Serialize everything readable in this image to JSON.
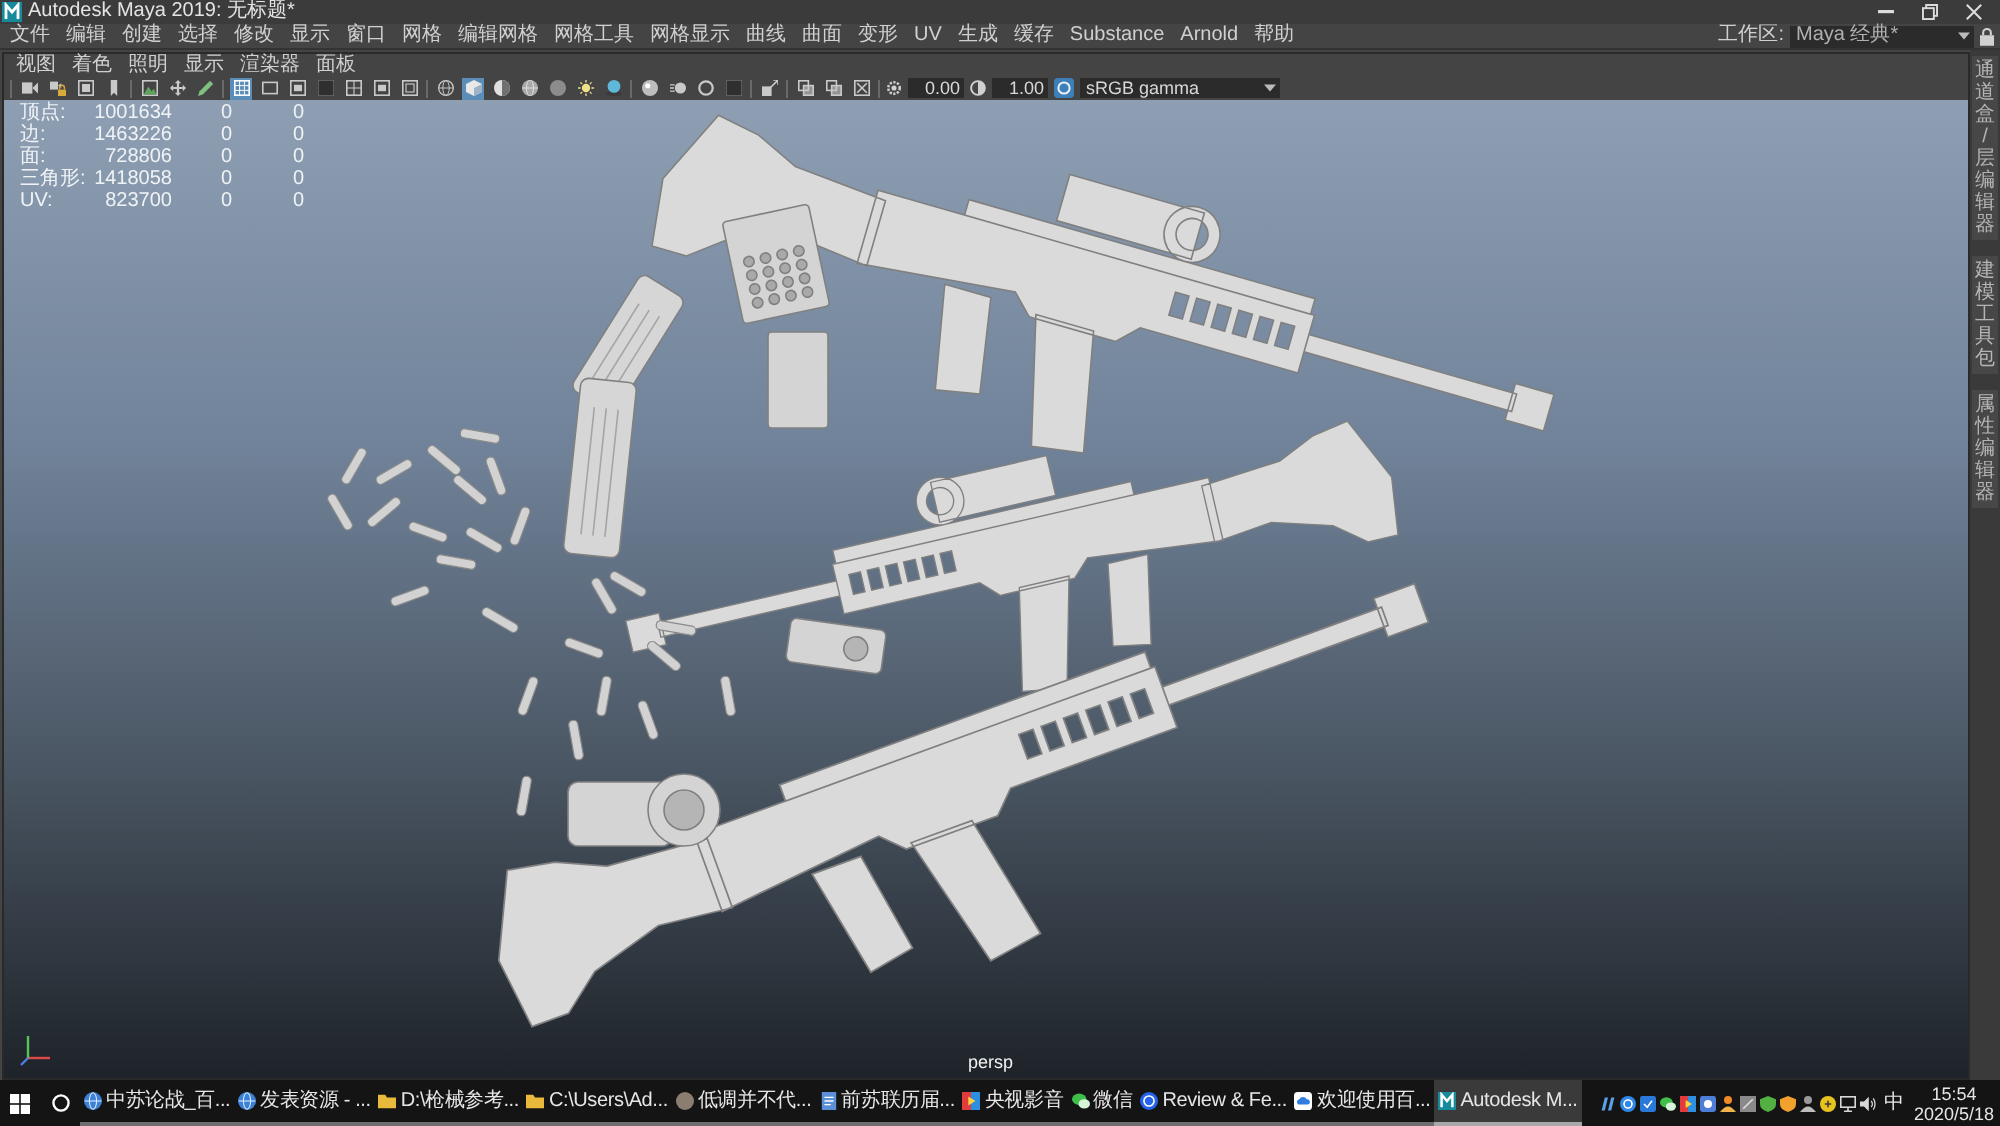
{
  "window": {
    "title": "Autodesk Maya 2019: 无标题*"
  },
  "menu_bar": {
    "items": [
      "文件",
      "编辑",
      "创建",
      "选择",
      "修改",
      "显示",
      "窗口",
      "网格",
      "编辑网格",
      "网格工具",
      "网格显示",
      "曲线",
      "曲面",
      "变形",
      "UV",
      "生成",
      "缓存",
      "Substance",
      "Arnold",
      "帮助"
    ],
    "workspace_label": "工作区:",
    "workspace": "Maya 经典*"
  },
  "panel_menu": [
    "视图",
    "着色",
    "照明",
    "显示",
    "渲染器",
    "面板"
  ],
  "toolbar": {
    "groups": [
      {
        "buttons": [
          {
            "kind": "camera",
            "selected": false
          },
          {
            "kind": "lock",
            "selected": false
          },
          {
            "kind": "film",
            "selected": false
          },
          {
            "kind": "bookmark",
            "selected": false
          }
        ]
      },
      {
        "buttons": [
          {
            "kind": "image",
            "selected": false
          },
          {
            "kind": "pan",
            "selected": false
          },
          {
            "kind": "pencil",
            "selected": false
          }
        ]
      },
      {
        "buttons": [
          {
            "kind": "grid",
            "selected": true
          },
          {
            "kind": "frame",
            "selected": false
          },
          {
            "kind": "gate",
            "selected": false
          },
          {
            "kind": "mask",
            "selected": false
          },
          {
            "kind": "split",
            "selected": false
          },
          {
            "kind": "gate",
            "selected": false
          },
          {
            "kind": "safe",
            "selected": false
          }
        ]
      },
      {
        "buttons": [
          {
            "kind": "wire",
            "selected": false
          },
          {
            "kind": "cube",
            "selected": true
          },
          {
            "kind": "halfsphere",
            "selected": false
          },
          {
            "kind": "wiresphere",
            "selected": false
          },
          {
            "kind": "sphere",
            "selected": false
          },
          {
            "kind": "light",
            "selected": false
          },
          {
            "kind": "shadow",
            "selected": false
          }
        ]
      },
      {
        "buttons": [
          {
            "kind": "ball",
            "selected": false
          },
          {
            "kind": "blur",
            "selected": false
          },
          {
            "kind": "ring",
            "selected": false
          },
          {
            "kind": "mask",
            "selected": false
          }
        ]
      },
      {
        "buttons": [
          {
            "kind": "isolate",
            "selected": false
          }
        ]
      },
      {
        "buttons": [
          {
            "kind": "xray",
            "selected": false
          },
          {
            "kind": "xray",
            "selected": false
          },
          {
            "kind": "cross",
            "selected": false
          }
        ]
      }
    ],
    "exposure": "0.00",
    "gamma": "1.00",
    "color_space": "sRGB gamma"
  },
  "viewport": {
    "stats": [
      {
        "label": "顶点:",
        "value": "1001634",
        "column_3": "0",
        "column_4": "0"
      },
      {
        "label": "边:",
        "value": "1463226",
        "column_3": "0",
        "column_4": "0"
      },
      {
        "label": "面:",
        "value": "728806",
        "column_3": "0",
        "column_4": "0"
      },
      {
        "label": "三角形:",
        "value": "1418058",
        "column_3": "0",
        "column_4": "0"
      },
      {
        "label": "UV:",
        "value": "823700",
        "column_3": "0",
        "column_4": "0"
      }
    ],
    "camera": "persp"
  },
  "side_tabs": [
    "通道盒/层编辑器",
    "建模工具包",
    "属性编辑器"
  ],
  "taskbar": {
    "tasks": [
      {
        "kind": "browser",
        "label": "中苏论战_百...",
        "selected": false
      },
      {
        "kind": "browser",
        "label": "发表资源 - ...",
        "selected": false
      },
      {
        "kind": "folder",
        "label": "D:\\枪械参考...",
        "selected": false
      },
      {
        "kind": "folder",
        "label": "C:\\Users\\Ad...",
        "selected": false
      },
      {
        "kind": "avatar",
        "label": "低调并不代...",
        "selected": false
      },
      {
        "kind": "document",
        "label": "前苏联历届...",
        "selected": false
      },
      {
        "kind": "video",
        "label": "央视影音",
        "selected": false
      },
      {
        "kind": "chat",
        "label": "微信",
        "selected": false
      },
      {
        "kind": "review",
        "label": "Review & Fe...",
        "selected": false
      },
      {
        "kind": "cloud",
        "label": "欢迎使用百...",
        "selected": false
      },
      {
        "kind": "maya",
        "label": "Autodesk M...",
        "selected": true
      }
    ],
    "input_method": "中",
    "time": "15:54",
    "date": "2020/5/18"
  }
}
